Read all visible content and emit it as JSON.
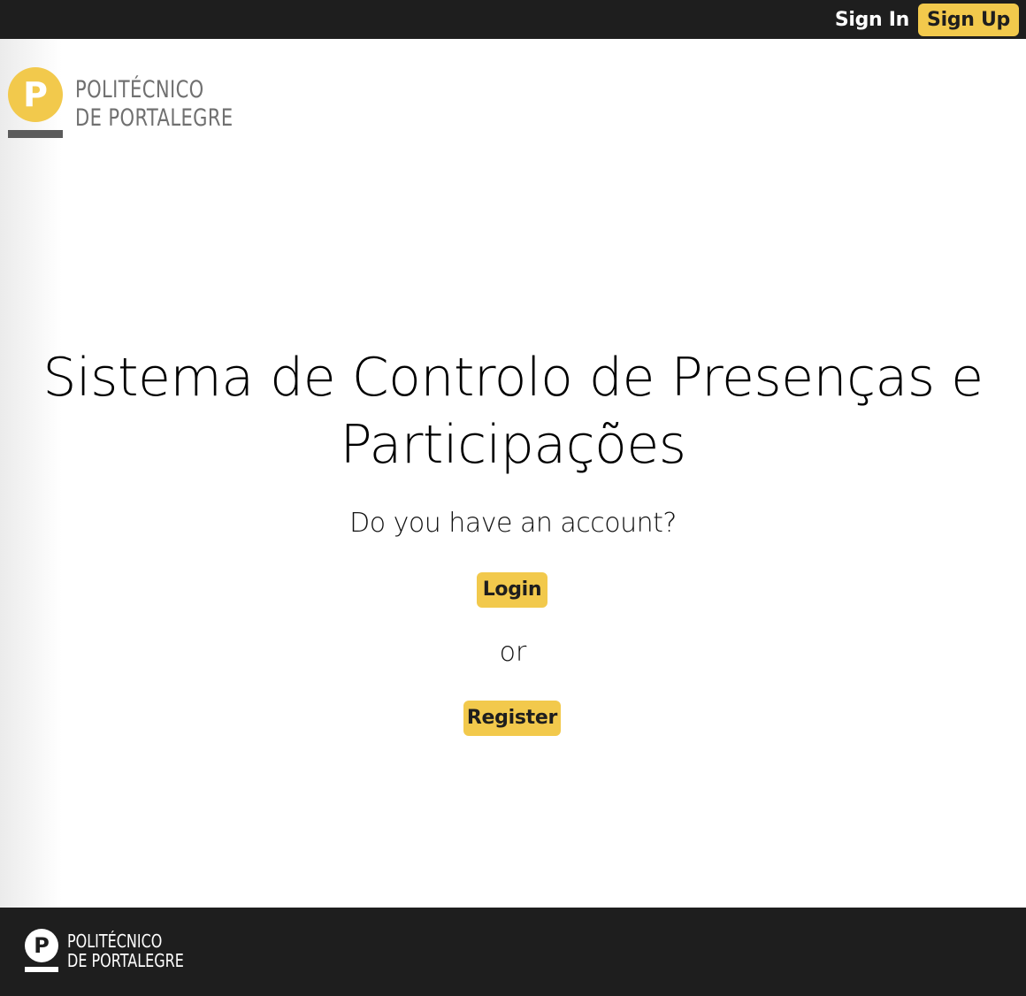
{
  "header": {
    "sign_in_label": "Sign In",
    "sign_up_label": "Sign Up"
  },
  "brand": {
    "logo_letter": "P",
    "name_line1": "POLITÉCNICO",
    "name_line2": "DE PORTALEGRE"
  },
  "main": {
    "title_line1": "Sistema de Controlo de Presenças e",
    "title_line2": "Participações",
    "question": "Do you have an account?",
    "login_label": "Login",
    "or_text": "or",
    "register_label": "Register"
  },
  "footer": {
    "logo_letter": "P",
    "name_line1": "POLITÉCNICO",
    "name_line2": "DE PORTALEGRE"
  },
  "colors": {
    "accent": "#f2c94c",
    "dark": "#1e1e1e",
    "logo_gray": "#707070"
  }
}
